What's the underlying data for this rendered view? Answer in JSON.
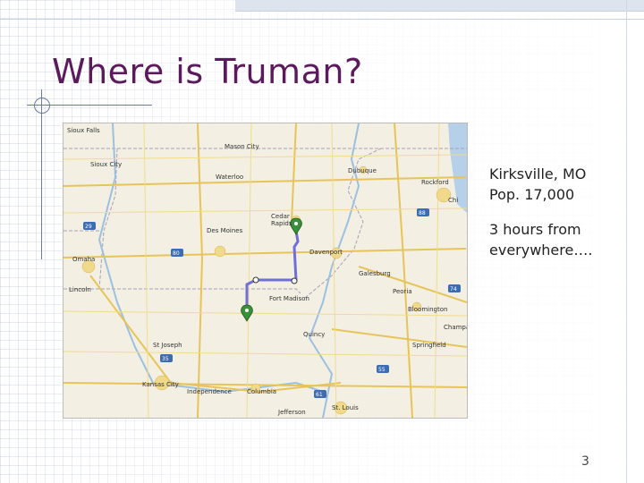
{
  "slide": {
    "title": "Where is Truman?",
    "bullets": [
      {
        "line1": "Kirksville, MO",
        "line2": "Pop. 17,000"
      },
      {
        "line1": "3 hours from",
        "line2": "everywhere…."
      }
    ],
    "page_number": "3"
  },
  "map": {
    "cities": [
      "Sioux Falls",
      "Des Moines",
      "Cedar Rapids",
      "Davenport",
      "Omaha",
      "Lincoln",
      "Kansas City",
      "Columbia",
      "Jefferson",
      "Peoria",
      "Bloomington",
      "Springfield",
      "St. Louis",
      "Dubuque",
      "Rockford",
      "Chicago",
      "Waterloo",
      "Mason City",
      "Sioux City",
      "Independence",
      "St Joseph",
      "Fort Madison",
      "Quincy",
      "Champaign",
      "Galesburg"
    ],
    "route_color": "#6f6fd6",
    "marker_color": "#3a8f3a"
  }
}
